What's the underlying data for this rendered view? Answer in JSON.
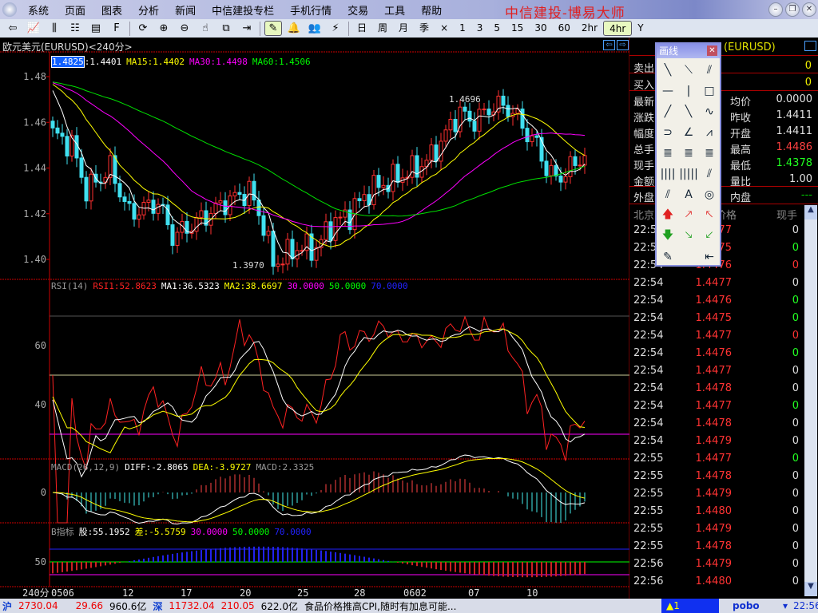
{
  "menu": {
    "items": [
      "系统",
      "页面",
      "图表",
      "分析",
      "新闻",
      "中信建投专栏",
      "手机行情",
      "交易",
      "工具",
      "帮助"
    ],
    "app_title": "中信建投-博易大师"
  },
  "toolbar": {
    "icons": [
      "back-icon",
      "line-chart-icon",
      "kline-icon",
      "table-icon",
      "news-icon",
      "f10-icon",
      "refresh-icon",
      "zoom-in-icon",
      "zoom-out-icon",
      "pointer-icon",
      "switch-icon",
      "export-icon",
      "draw-icon",
      "alarm-icon",
      "users-icon",
      "flash-icon"
    ],
    "periods": [
      "日",
      "周",
      "月",
      "季",
      "×",
      "1",
      "3",
      "5",
      "15",
      "30",
      "60",
      "2hr",
      "4hr",
      "Y"
    ],
    "active_period": "4hr"
  },
  "chart": {
    "title": "欧元美元(EURUSD)<240分>",
    "price_legend": {
      "cursor": "1.4825",
      "ma5": ":1.4401",
      "ma15": "MA15:1.4402",
      "ma30": "MA30:1.4498",
      "ma60": "MA60:1.4506"
    },
    "rsi_legend": {
      "name": "RSI(14)",
      "rsi1": "RSI1:52.8623",
      "ma1": "MA1:36.5323",
      "ma2": "MA2:38.6697",
      "l30": "30.0000",
      "l50": "50.0000",
      "l70": "70.0000"
    },
    "macd_legend": {
      "name": "MACD(26,12,9)",
      "diff": "DIFF:-2.8065",
      "dea": "DEA:-3.9727",
      "macd": "MACD:2.3325"
    },
    "b_legend": {
      "name": "B指标",
      "gu": "股:55.1952",
      "cha": "差:-5.5759",
      "l30": "30.0000",
      "l50": "50.0000",
      "l70": "70.0000"
    },
    "high_label": "1.4696",
    "low_label": "1.3970"
  },
  "chart_data": {
    "type": "candlestick",
    "symbol": "EURUSD",
    "period": "240分",
    "price_ticks": [
      "1.48",
      "1.46",
      "1.44",
      "1.42",
      "1.40"
    ],
    "price_ylim": [
      1.3892,
      1.4906
    ],
    "rsi_ticks": [
      "60",
      "40"
    ],
    "macd_ticks": [
      "0"
    ],
    "b_ticks": [
      "50"
    ],
    "x_labels": [
      "240分",
      "0506",
      "12",
      "17",
      "20",
      "25",
      "28",
      "0602",
      "07",
      "10"
    ],
    "candle_count": 112,
    "warmup_close": 1.478,
    "close_keypoints": [
      [
        0,
        1.455
      ],
      [
        4,
        1.45
      ],
      [
        7,
        1.43
      ],
      [
        12,
        1.44
      ],
      [
        16,
        1.42
      ],
      [
        22,
        1.425
      ],
      [
        25,
        1.41
      ],
      [
        29,
        1.415
      ],
      [
        36,
        1.425
      ],
      [
        41,
        1.43
      ],
      [
        44,
        1.415
      ],
      [
        46,
        1.398
      ],
      [
        51,
        1.405
      ],
      [
        55,
        1.405
      ],
      [
        58,
        1.415
      ],
      [
        62,
        1.42
      ],
      [
        66,
        1.43
      ],
      [
        71,
        1.435
      ],
      [
        76,
        1.44
      ],
      [
        79,
        1.445
      ],
      [
        82,
        1.455
      ],
      [
        85,
        1.465
      ],
      [
        87,
        1.46
      ],
      [
        91,
        1.465
      ],
      [
        92,
        1.468
      ],
      [
        96,
        1.465
      ],
      [
        98,
        1.458
      ],
      [
        101,
        1.45
      ],
      [
        103,
        1.44
      ],
      [
        105,
        1.435
      ],
      [
        108,
        1.44
      ],
      [
        111,
        1.446
      ]
    ],
    "ma_periods": [
      5,
      15,
      30,
      60
    ],
    "colors": {
      "up": "#ff3030",
      "down": "#40e0f0",
      "ma5": "#ffffff",
      "ma15": "#ffff00",
      "ma30": "#ff00ff",
      "ma60": "#00e000"
    }
  },
  "quote": {
    "title": "(EURUSD)",
    "sell_label": "卖出",
    "sell": "0",
    "buy_label": "买入",
    "buy": "0",
    "left_labels": [
      "最新",
      "涨跌",
      "幅度",
      "总手",
      "现手",
      "金额"
    ],
    "fields": [
      {
        "label": "均价",
        "value": "0.0000",
        "color": "#e0e0e0"
      },
      {
        "label": "昨收",
        "value": "1.4411",
        "color": "#e0e0e0"
      },
      {
        "label": "开盘",
        "value": "1.4411",
        "color": "#e0e0e0"
      },
      {
        "label": "最高",
        "value": "1.4486",
        "color": "#ff4040"
      },
      {
        "label": "最低",
        "value": "1.4378",
        "color": "#20ff20"
      },
      {
        "label": "量比",
        "value": "1.00",
        "color": "#e0e0e0"
      }
    ],
    "outer_label": "外盘",
    "inner_label": "内盘",
    "inner": "---",
    "tick_header": {
      "time": "北京",
      "price": "价格",
      "vol": "现手"
    }
  },
  "ticks": [
    [
      "22:54",
      "1.4477",
      "0",
      "w"
    ],
    [
      "22:54",
      "1.4475",
      "0",
      "g"
    ],
    [
      "22:54",
      "1.4476",
      "0",
      "r"
    ],
    [
      "22:54",
      "1.4477",
      "0",
      "w"
    ],
    [
      "22:54",
      "1.4476",
      "0",
      "g"
    ],
    [
      "22:54",
      "1.4475",
      "0",
      "g"
    ],
    [
      "22:54",
      "1.4477",
      "0",
      "r"
    ],
    [
      "22:54",
      "1.4476",
      "0",
      "g"
    ],
    [
      "22:54",
      "1.4477",
      "0",
      "w"
    ],
    [
      "22:54",
      "1.4478",
      "0",
      "w"
    ],
    [
      "22:54",
      "1.4477",
      "0",
      "g"
    ],
    [
      "22:54",
      "1.4478",
      "0",
      "w"
    ],
    [
      "22:54",
      "1.4479",
      "0",
      "w"
    ],
    [
      "22:55",
      "1.4477",
      "0",
      "g"
    ],
    [
      "22:55",
      "1.4478",
      "0",
      "w"
    ],
    [
      "22:55",
      "1.4479",
      "0",
      "w"
    ],
    [
      "22:55",
      "1.4480",
      "0",
      "w"
    ],
    [
      "22:55",
      "1.4479",
      "0",
      "w"
    ],
    [
      "22:55",
      "1.4478",
      "0",
      "w"
    ],
    [
      "22:56",
      "1.4479",
      "0",
      "w"
    ],
    [
      "22:56",
      "1.4480",
      "0",
      "w"
    ]
  ],
  "draw_panel": {
    "title": "画线",
    "tools": [
      "╲",
      "⟍",
      "⫽",
      "—",
      "|",
      "□",
      "╱",
      "╲",
      "∿",
      "⊃",
      "∠",
      "⩘",
      "≣",
      "≣",
      "≣",
      "||||",
      "|||||",
      "⫽",
      "⫽",
      "A",
      "◎",
      "🡅",
      "🡕",
      "🡔",
      "🡇",
      "🡖",
      "🡗",
      "✎",
      "",
      "⇤"
    ]
  },
  "status": {
    "sh_label": "沪",
    "sh_index": "2730.04",
    "sh_change": "29.66",
    "sh_amount": "960.6亿",
    "sz_label": "深",
    "sz_index": "11732.04",
    "sz_change": "210.05",
    "sz_amount": "622.0亿",
    "news": "食品价格推高CPI,随时有加息可能...",
    "alert": "1",
    "brand": "pobo",
    "time": "22:56"
  }
}
